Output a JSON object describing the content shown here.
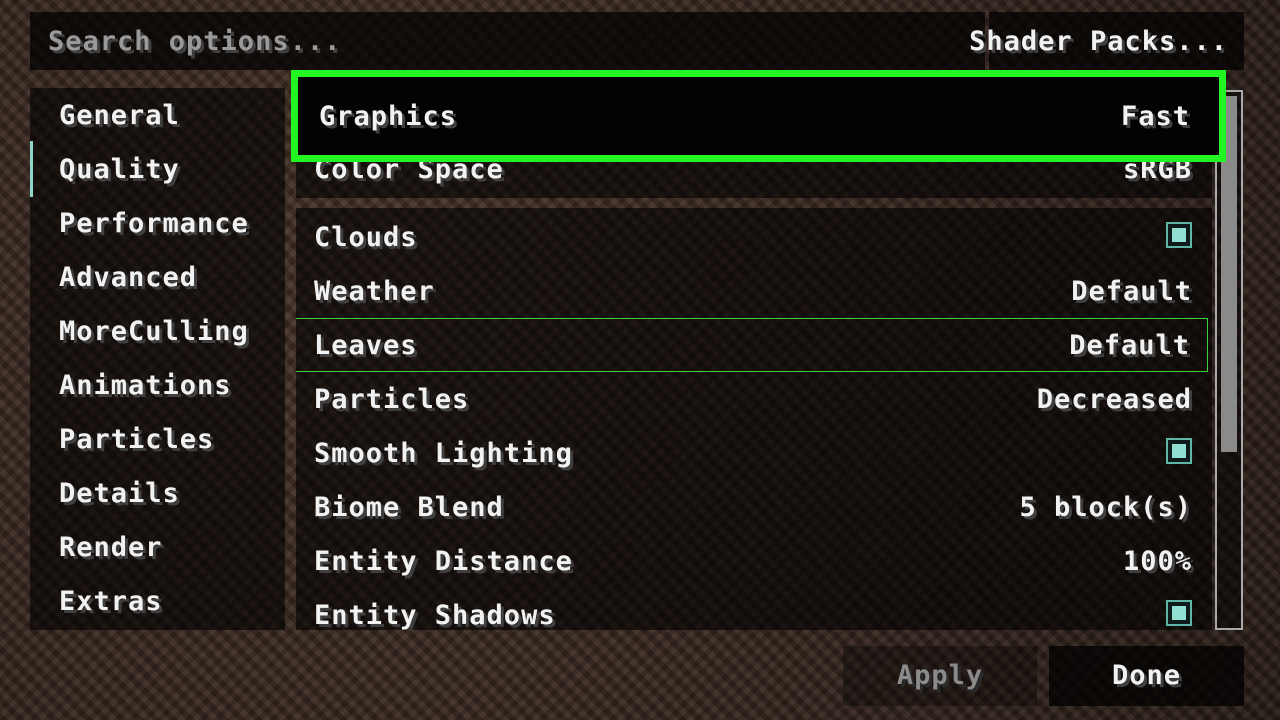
{
  "search": {
    "placeholder": "Search options..."
  },
  "header": {
    "shader_packs_label": "Shader Packs..."
  },
  "sidebar": {
    "active": "Quality",
    "items": [
      {
        "label": "General"
      },
      {
        "label": "Quality"
      },
      {
        "label": "Performance"
      },
      {
        "label": "Advanced"
      },
      {
        "label": "MoreCulling"
      },
      {
        "label": "Animations"
      },
      {
        "label": "Particles"
      },
      {
        "label": "Details"
      },
      {
        "label": "Render"
      },
      {
        "label": "Extras"
      }
    ]
  },
  "options": {
    "group1": [
      {
        "label": "Graphics",
        "value": "Fast"
      },
      {
        "label": "Color Space",
        "value": "sRGB"
      }
    ],
    "group2": [
      {
        "label": "Clouds",
        "type": "checkbox",
        "checked": true
      },
      {
        "label": "Weather",
        "value": "Default"
      },
      {
        "label": "Leaves",
        "value": "Default",
        "hovered": true
      },
      {
        "label": "Particles",
        "value": "Decreased"
      },
      {
        "label": "Smooth Lighting",
        "type": "checkbox",
        "checked": true
      },
      {
        "label": "Biome Blend",
        "value": "5 block(s)"
      },
      {
        "label": "Entity Distance",
        "value": "100%"
      },
      {
        "label": "Entity Shadows",
        "type": "checkbox",
        "checked": true
      }
    ]
  },
  "footer": {
    "apply_label": "Apply",
    "done_label": "Done"
  },
  "colors": {
    "highlight": "#22f522",
    "hover_outline": "#3bd23b",
    "checkbox_fill": "#8fe0d2",
    "accent": "#8fd6c8"
  }
}
